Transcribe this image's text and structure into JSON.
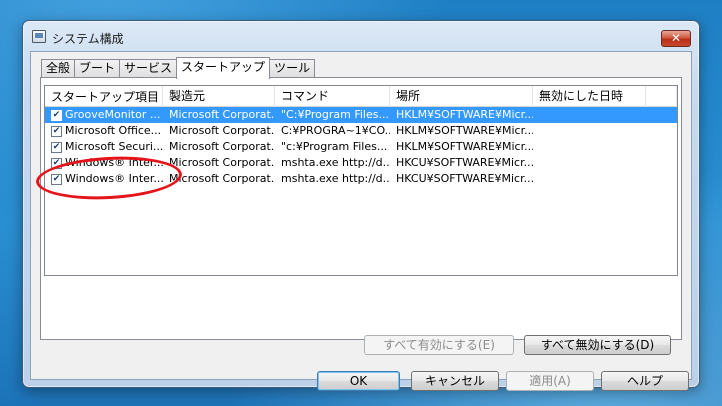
{
  "window": {
    "title": "システム構成",
    "close_label": "✕"
  },
  "tabs": [
    {
      "label": "全般"
    },
    {
      "label": "ブート"
    },
    {
      "label": "サービス"
    },
    {
      "label": "スタートアップ"
    },
    {
      "label": "ツール"
    }
  ],
  "startup_table": {
    "columns": [
      "スタートアップ項目",
      "製造元",
      "コマンド",
      "場所",
      "無効にした日時"
    ],
    "rows": [
      {
        "checked": true,
        "item": "GrooveMonitor ...",
        "maker": "Microsoft Corporat...",
        "command": "\"C:¥Program Files...",
        "location": "HKLM¥SOFTWARE¥Micr...",
        "disabled_at": ""
      },
      {
        "checked": true,
        "item": "Microsoft Office...",
        "maker": "Microsoft Corporat...",
        "command": "C:¥PROGRA~1¥CO...",
        "location": "HKLM¥SOFTWARE¥Micr...",
        "disabled_at": ""
      },
      {
        "checked": true,
        "item": "Microsoft Securi...",
        "maker": "Microsoft Corporat...",
        "command": "\"c:¥Program Files...",
        "location": "HKLM¥SOFTWARE¥Micr...",
        "disabled_at": ""
      },
      {
        "checked": true,
        "item": "Windows® Inter...",
        "maker": "Microsoft Corporat...",
        "command": "mshta.exe http://d...",
        "location": "HKCU¥SOFTWARE¥Micr...",
        "disabled_at": ""
      },
      {
        "checked": true,
        "item": "Windows® Inter...",
        "maker": "Microsoft Corporat...",
        "command": "mshta.exe http://d...",
        "location": "HKCU¥SOFTWARE¥Micr...",
        "disabled_at": ""
      }
    ]
  },
  "buttons": {
    "enable_all": "すべて有効にする(E)",
    "disable_all": "すべて無効にする(D)",
    "ok": "OK",
    "cancel": "キャンセル",
    "apply": "適用(A)",
    "help": "ヘルプ"
  },
  "colors": {
    "selection": "#3399ff",
    "annotation": "#e3151a"
  }
}
